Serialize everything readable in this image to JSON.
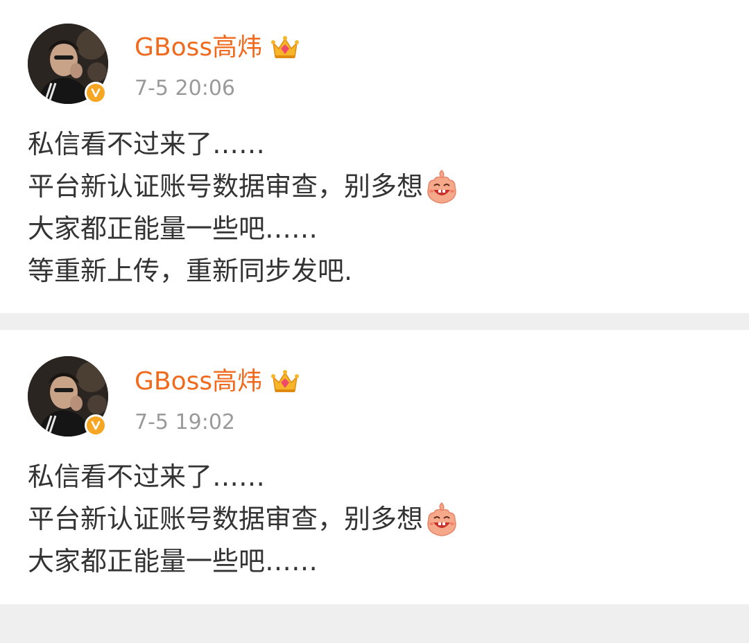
{
  "posts": [
    {
      "username": "GBoss高炜",
      "timestamp": "7-5 20:06",
      "lines": [
        "私信看不过来了……",
        "平台新认证账号数据审查，别多想",
        "大家都正能量一些吧……",
        "等重新上传，重新同步发吧."
      ],
      "emoji_after_line": 1,
      "emoji": "laughing-emoji",
      "badge": "crown-icon",
      "verified": "verified-v-icon"
    },
    {
      "username": "GBoss高炜",
      "timestamp": "7-5 19:02",
      "lines": [
        "私信看不过来了……",
        "平台新认证账号数据审查，别多想",
        "大家都正能量一些吧……"
      ],
      "emoji_after_line": 1,
      "emoji": "laughing-emoji",
      "badge": "crown-icon",
      "verified": "verified-v-icon"
    }
  ],
  "colors": {
    "username": "#f06a1d",
    "timestamp": "#9a9a9a",
    "body_text": "#333333",
    "verified_badge": "#f5a623",
    "separator": "#efefef"
  }
}
